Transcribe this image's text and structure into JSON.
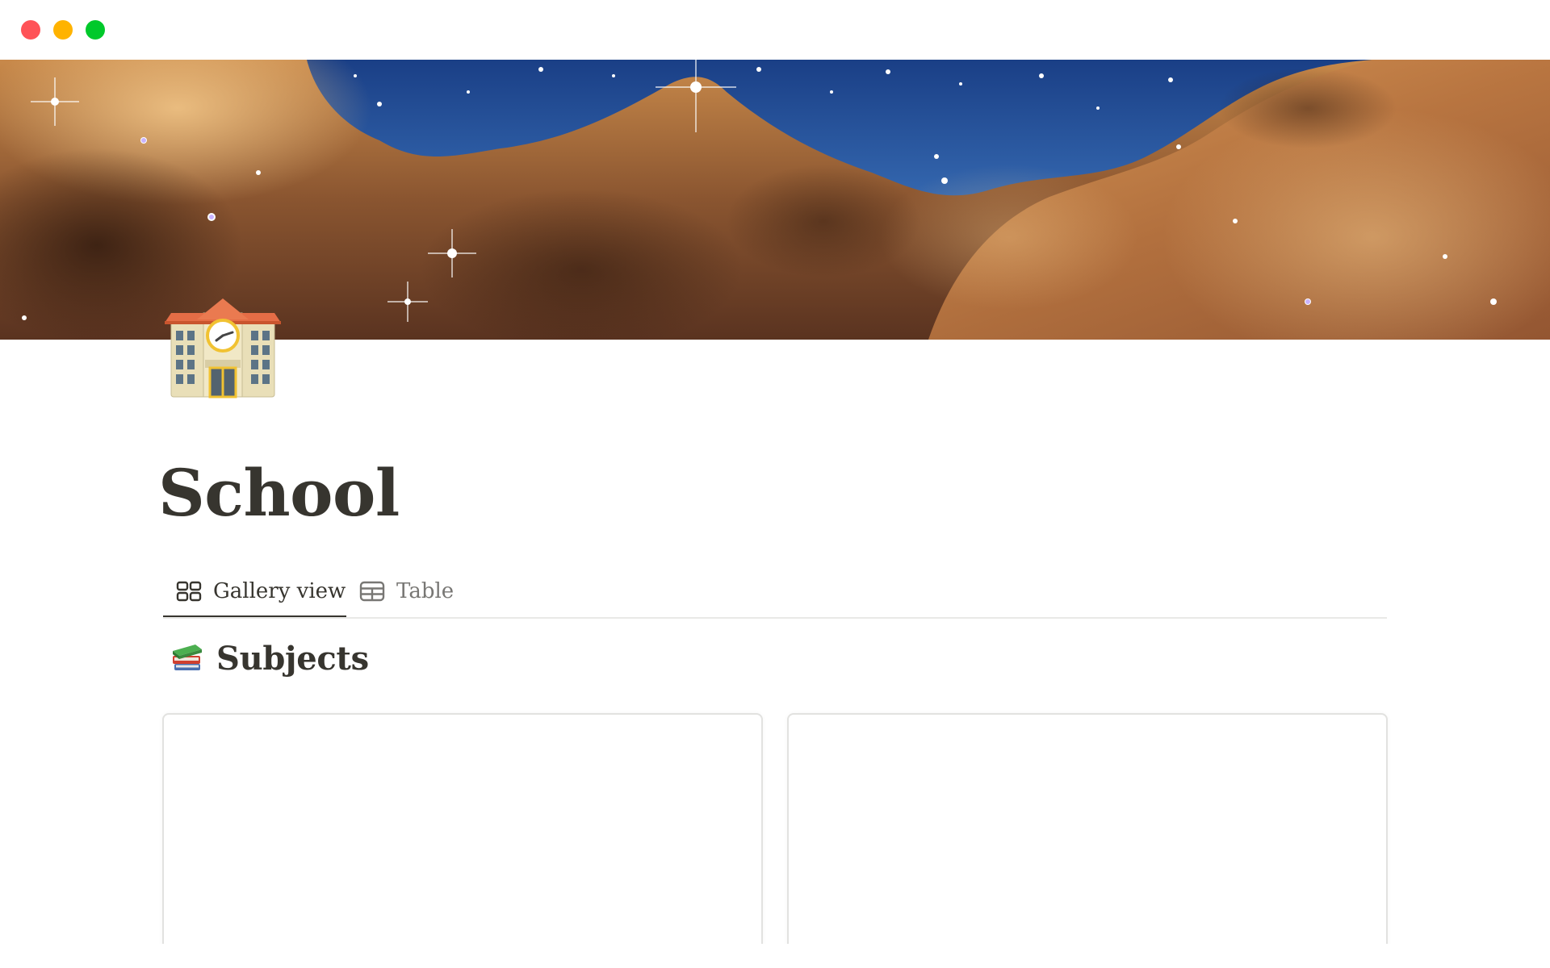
{
  "window": {
    "controls": [
      {
        "name": "close",
        "color": "#ff5257"
      },
      {
        "name": "minimize",
        "color": "#ffb300"
      },
      {
        "name": "maximize",
        "color": "#00c92b"
      }
    ]
  },
  "page": {
    "cover": {
      "description": "nebula-cover-image"
    },
    "icon": "school-building-icon",
    "title": "School"
  },
  "views": {
    "tabs": [
      {
        "label": "Gallery view",
        "icon": "gallery-grid-icon",
        "active": true
      },
      {
        "label": "Table",
        "icon": "table-icon",
        "active": false
      }
    ]
  },
  "database": {
    "icon": "books-icon",
    "title": "Subjects",
    "cards": [
      {
        "title": ""
      },
      {
        "title": ""
      }
    ]
  },
  "colors": {
    "text": "#37352f",
    "muted_text": "#787774",
    "divider": "#e9e9e7",
    "card_border": "#e2e2e0"
  }
}
